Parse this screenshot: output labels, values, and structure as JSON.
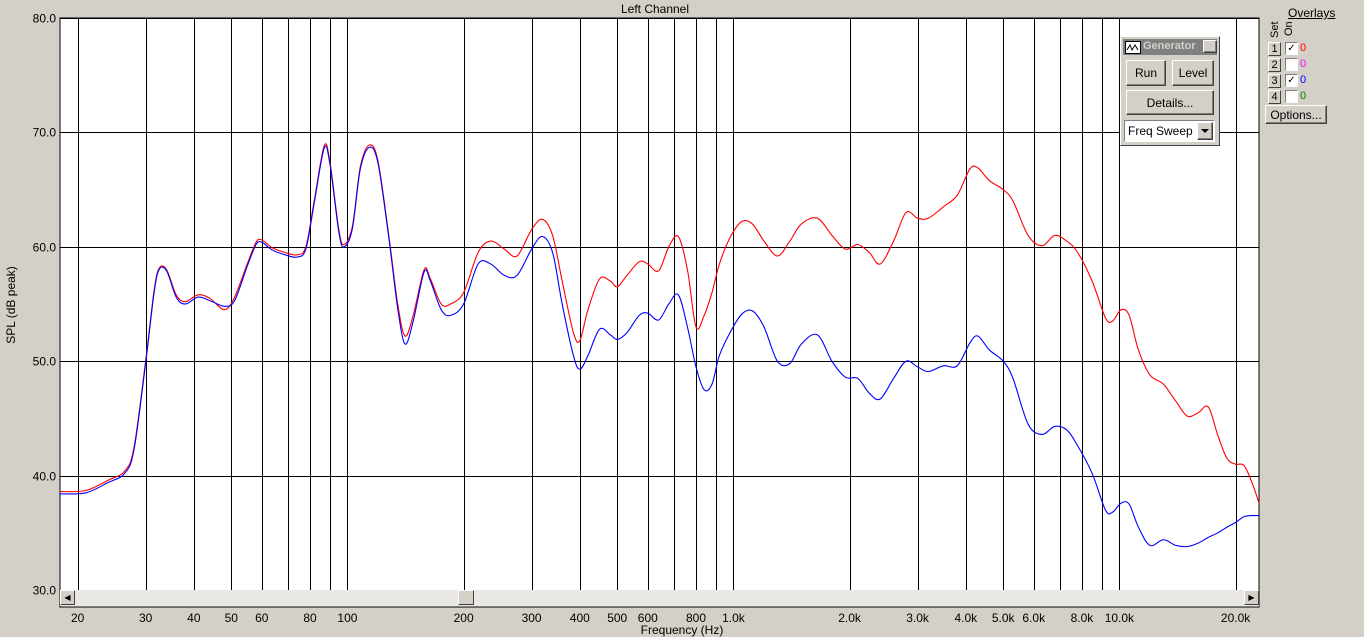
{
  "window_title": "Left Channel",
  "generator": {
    "title": "Generator",
    "close_label": "X",
    "run_label": "Run",
    "level_label": "Level",
    "details_label": "Details...",
    "mode": "Freq Sweep"
  },
  "overlays": {
    "header": "Overlays",
    "set_label": "Set",
    "on_label": "On",
    "rows": [
      {
        "num": "1",
        "checked": true,
        "value": "0",
        "color": "#ff0000"
      },
      {
        "num": "2",
        "checked": false,
        "value": "0",
        "color": "#ff00ff"
      },
      {
        "num": "3",
        "checked": true,
        "value": "0",
        "color": "#0000ff"
      },
      {
        "num": "4",
        "checked": false,
        "value": "0",
        "color": "#008000"
      }
    ],
    "options_label": "Options..."
  },
  "chart_data": {
    "type": "line",
    "title": "Left Channel",
    "xlabel": "Frequency (Hz)",
    "ylabel": "SPL (dB peak)",
    "x_scale": "log",
    "xlim": [
      18,
      23000
    ],
    "ylim": [
      30,
      80
    ],
    "grid": true,
    "y_ticks": [
      "30.0",
      "40.0",
      "50.0",
      "60.0",
      "70.0",
      "80.0"
    ],
    "y_tick_values": [
      30,
      40,
      50,
      60,
      70,
      80
    ],
    "x_gridlines": [
      20,
      30,
      40,
      50,
      60,
      70,
      80,
      90,
      100,
      200,
      300,
      400,
      500,
      600,
      700,
      800,
      900,
      1000,
      2000,
      3000,
      4000,
      5000,
      6000,
      7000,
      8000,
      9000,
      10000,
      20000
    ],
    "x_ticks": [
      {
        "v": 20,
        "label": "20"
      },
      {
        "v": 30,
        "label": "30"
      },
      {
        "v": 40,
        "label": "40"
      },
      {
        "v": 50,
        "label": "50"
      },
      {
        "v": 60,
        "label": "60"
      },
      {
        "v": 80,
        "label": "80"
      },
      {
        "v": 100,
        "label": "100"
      },
      {
        "v": 200,
        "label": "200"
      },
      {
        "v": 300,
        "label": "300"
      },
      {
        "v": 400,
        "label": "400"
      },
      {
        "v": 500,
        "label": "500"
      },
      {
        "v": 600,
        "label": "600"
      },
      {
        "v": 800,
        "label": "800"
      },
      {
        "v": 1000,
        "label": "1.0k"
      },
      {
        "v": 2000,
        "label": "2.0k"
      },
      {
        "v": 3000,
        "label": "3.0k"
      },
      {
        "v": 4000,
        "label": "4.0k"
      },
      {
        "v": 5000,
        "label": "5.0k"
      },
      {
        "v": 6000,
        "label": "6.0k"
      },
      {
        "v": 8000,
        "label": "8.0k"
      },
      {
        "v": 10000,
        "label": "10.0k"
      },
      {
        "v": 20000,
        "label": "20.0k"
      }
    ],
    "series": [
      {
        "color": "#ff0000",
        "points": [
          [
            18,
            38.6
          ],
          [
            21,
            38.7
          ],
          [
            24,
            39.6
          ],
          [
            26.5,
            40.4
          ],
          [
            28,
            42.5
          ],
          [
            30,
            50
          ],
          [
            31.5,
            56
          ],
          [
            32.5,
            58.1
          ],
          [
            34,
            58
          ],
          [
            36,
            55.8
          ],
          [
            38,
            55.2
          ],
          [
            41,
            55.8
          ],
          [
            44,
            55.5
          ],
          [
            48,
            54.5
          ],
          [
            51,
            55.6
          ],
          [
            55,
            58.5
          ],
          [
            58,
            60.4
          ],
          [
            60,
            60.6
          ],
          [
            64,
            59.9
          ],
          [
            69,
            59.5
          ],
          [
            74,
            59.3
          ],
          [
            78,
            60
          ],
          [
            82,
            64
          ],
          [
            87,
            68.8
          ],
          [
            90,
            67.5
          ],
          [
            95,
            61.5
          ],
          [
            98,
            60.2
          ],
          [
            103,
            61.8
          ],
          [
            108,
            67
          ],
          [
            114,
            68.9
          ],
          [
            120,
            67.5
          ],
          [
            128,
            61
          ],
          [
            135,
            55
          ],
          [
            141,
            52.2
          ],
          [
            148,
            54
          ],
          [
            158,
            58
          ],
          [
            164,
            57.2
          ],
          [
            175,
            55
          ],
          [
            185,
            55
          ],
          [
            200,
            56
          ],
          [
            218,
            59.5
          ],
          [
            235,
            60.5
          ],
          [
            255,
            59.8
          ],
          [
            275,
            59.2
          ],
          [
            300,
            61.5
          ],
          [
            320,
            62.4
          ],
          [
            340,
            61
          ],
          [
            360,
            57
          ],
          [
            385,
            52.5
          ],
          [
            400,
            51.8
          ],
          [
            420,
            54.5
          ],
          [
            450,
            57.2
          ],
          [
            480,
            57
          ],
          [
            500,
            56.5
          ],
          [
            530,
            57.5
          ],
          [
            570,
            58.7
          ],
          [
            600,
            58.5
          ],
          [
            640,
            57.9
          ],
          [
            680,
            60
          ],
          [
            720,
            60.9
          ],
          [
            760,
            58
          ],
          [
            800,
            53
          ],
          [
            840,
            54
          ],
          [
            880,
            56
          ],
          [
            920,
            58.5
          ],
          [
            980,
            60.8
          ],
          [
            1050,
            62.2
          ],
          [
            1120,
            62
          ],
          [
            1200,
            60.5
          ],
          [
            1300,
            59.2
          ],
          [
            1400,
            60.5
          ],
          [
            1500,
            62
          ],
          [
            1650,
            62.5
          ],
          [
            1800,
            61
          ],
          [
            1950,
            59.8
          ],
          [
            2100,
            60.2
          ],
          [
            2250,
            59.5
          ],
          [
            2400,
            58.5
          ],
          [
            2600,
            60.5
          ],
          [
            2800,
            63
          ],
          [
            3000,
            62.5
          ],
          [
            3200,
            62.5
          ],
          [
            3500,
            63.5
          ],
          [
            3800,
            64.5
          ],
          [
            4100,
            66.8
          ],
          [
            4300,
            66.9
          ],
          [
            4600,
            65.8
          ],
          [
            5000,
            65
          ],
          [
            5300,
            64
          ],
          [
            5800,
            61
          ],
          [
            6300,
            60.1
          ],
          [
            6800,
            61
          ],
          [
            7300,
            60.5
          ],
          [
            7800,
            59.5
          ],
          [
            8500,
            57
          ],
          [
            9200,
            53.8
          ],
          [
            9600,
            53.5
          ],
          [
            10100,
            54.5
          ],
          [
            10600,
            54
          ],
          [
            11200,
            51
          ],
          [
            12000,
            48.8
          ],
          [
            13000,
            48
          ],
          [
            14000,
            46.5
          ],
          [
            15000,
            45.2
          ],
          [
            16000,
            45.5
          ],
          [
            17000,
            46
          ],
          [
            18000,
            43.5
          ],
          [
            19000,
            41.5
          ],
          [
            20000,
            41
          ],
          [
            21000,
            40.9
          ],
          [
            22000,
            39.5
          ],
          [
            23000,
            37.6
          ]
        ]
      },
      {
        "color": "#0000ff",
        "points": [
          [
            18,
            38.4
          ],
          [
            21,
            38.5
          ],
          [
            24,
            39.4
          ],
          [
            26.5,
            40.2
          ],
          [
            28,
            42.3
          ],
          [
            30,
            49.8
          ],
          [
            31.5,
            55.8
          ],
          [
            32.5,
            58
          ],
          [
            34,
            57.9
          ],
          [
            36,
            55.6
          ],
          [
            38,
            55
          ],
          [
            41,
            55.6
          ],
          [
            44,
            55.3
          ],
          [
            48,
            54.8
          ],
          [
            51,
            55.3
          ],
          [
            55,
            58.3
          ],
          [
            58,
            60.2
          ],
          [
            60,
            60.4
          ],
          [
            64,
            59.7
          ],
          [
            69,
            59.3
          ],
          [
            74,
            59.1
          ],
          [
            78,
            59.8
          ],
          [
            82,
            63.8
          ],
          [
            87,
            68.6
          ],
          [
            90,
            67.3
          ],
          [
            95,
            61.3
          ],
          [
            98,
            60
          ],
          [
            103,
            61.6
          ],
          [
            108,
            66.8
          ],
          [
            114,
            68.7
          ],
          [
            120,
            67.3
          ],
          [
            128,
            60.8
          ],
          [
            135,
            54.6
          ],
          [
            141,
            51.5
          ],
          [
            148,
            53.5
          ],
          [
            158,
            57.8
          ],
          [
            164,
            57
          ],
          [
            175,
            54.5
          ],
          [
            185,
            54
          ],
          [
            200,
            55
          ],
          [
            218,
            58.5
          ],
          [
            235,
            58.5
          ],
          [
            255,
            57.5
          ],
          [
            275,
            57.5
          ],
          [
            300,
            59.8
          ],
          [
            320,
            60.9
          ],
          [
            340,
            59.5
          ],
          [
            360,
            55
          ],
          [
            385,
            50.5
          ],
          [
            400,
            49.3
          ],
          [
            420,
            50.5
          ],
          [
            450,
            52.8
          ],
          [
            480,
            52.3
          ],
          [
            500,
            51.9
          ],
          [
            530,
            52.5
          ],
          [
            570,
            54
          ],
          [
            600,
            54.2
          ],
          [
            640,
            53.6
          ],
          [
            680,
            55
          ],
          [
            720,
            55.8
          ],
          [
            760,
            53
          ],
          [
            800,
            49.5
          ],
          [
            840,
            47.5
          ],
          [
            880,
            48
          ],
          [
            920,
            50.5
          ],
          [
            980,
            52.5
          ],
          [
            1050,
            54.1
          ],
          [
            1120,
            54.4
          ],
          [
            1200,
            53
          ],
          [
            1300,
            50
          ],
          [
            1400,
            49.8
          ],
          [
            1500,
            51.5
          ],
          [
            1650,
            52.3
          ],
          [
            1800,
            50
          ],
          [
            1950,
            48.6
          ],
          [
            2100,
            48.5
          ],
          [
            2250,
            47.2
          ],
          [
            2400,
            46.7
          ],
          [
            2600,
            48.5
          ],
          [
            2800,
            50
          ],
          [
            3000,
            49.5
          ],
          [
            3200,
            49.1
          ],
          [
            3500,
            49.6
          ],
          [
            3800,
            49.6
          ],
          [
            4100,
            51.6
          ],
          [
            4300,
            52.2
          ],
          [
            4600,
            51
          ],
          [
            5000,
            50
          ],
          [
            5300,
            48.5
          ],
          [
            5800,
            44.5
          ],
          [
            6300,
            43.6
          ],
          [
            6800,
            44.3
          ],
          [
            7300,
            44
          ],
          [
            7800,
            42.6
          ],
          [
            8500,
            40.2
          ],
          [
            9200,
            37
          ],
          [
            9600,
            36.8
          ],
          [
            10100,
            37.6
          ],
          [
            10600,
            37.5
          ],
          [
            11200,
            35.5
          ],
          [
            12000,
            33.9
          ],
          [
            13000,
            34.4
          ],
          [
            14000,
            33.9
          ],
          [
            15000,
            33.8
          ],
          [
            16000,
            34.1
          ],
          [
            17000,
            34.6
          ],
          [
            18000,
            35
          ],
          [
            19000,
            35.5
          ],
          [
            20000,
            35.9
          ],
          [
            21000,
            36.4
          ],
          [
            22000,
            36.5
          ],
          [
            23000,
            36.5
          ]
        ]
      }
    ]
  }
}
